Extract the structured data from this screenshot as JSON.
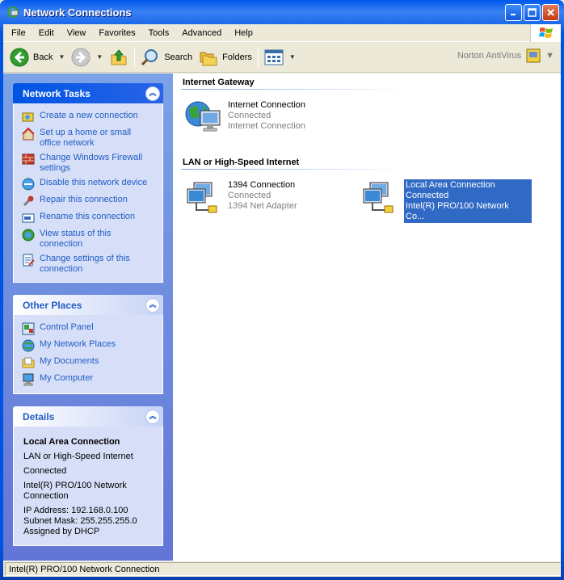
{
  "window": {
    "title": "Network Connections"
  },
  "menu": [
    "File",
    "Edit",
    "View",
    "Favorites",
    "Tools",
    "Advanced",
    "Help"
  ],
  "toolbar": {
    "back_label": "Back",
    "search_label": "Search",
    "folders_label": "Folders",
    "norton_label": "Norton AntiVirus"
  },
  "network_tasks": {
    "title": "Network Tasks",
    "items": [
      [
        "Create a new connection"
      ],
      [
        "Set up a home or small",
        "office network"
      ],
      [
        "Change Windows Firewall",
        "settings"
      ],
      [
        "Disable this network device"
      ],
      [
        "Repair this connection"
      ],
      [
        "Rename this connection"
      ],
      [
        "View status of this",
        "connection"
      ],
      [
        "Change settings of this",
        "connection"
      ]
    ]
  },
  "other_places": {
    "title": "Other Places",
    "items": [
      "Control Panel",
      "My Network Places",
      "My Documents",
      "My Computer"
    ]
  },
  "details": {
    "title": "Details",
    "name": "Local Area Connection",
    "type": "LAN or High-Speed Internet",
    "status": "Connected",
    "adapter_1": "Intel(R) PRO/100 Network",
    "adapter_2": "Connection",
    "ip": "IP Address: 192.168.0.100",
    "mask": "Subnet Mask: 255.255.255.0",
    "assigned": "Assigned by DHCP"
  },
  "sections": {
    "gateway_title": "Internet Gateway",
    "lan_title": "LAN or High-Speed Internet"
  },
  "connections": {
    "internet": {
      "name": "Internet Connection",
      "status": "Connected",
      "device": "Internet Connection"
    },
    "c1394": {
      "name": "1394 Connection",
      "status": "Connected",
      "device": "1394 Net Adapter"
    },
    "lan": {
      "name": "Local Area Connection",
      "status": "Connected",
      "device": "Intel(R) PRO/100 Network Co..."
    }
  },
  "status_bar": "Intel(R) PRO/100 Network Connection",
  "colors": {
    "title_blue": "#0054e3",
    "task_link": "#215dc6",
    "selection": "#316ac5"
  }
}
